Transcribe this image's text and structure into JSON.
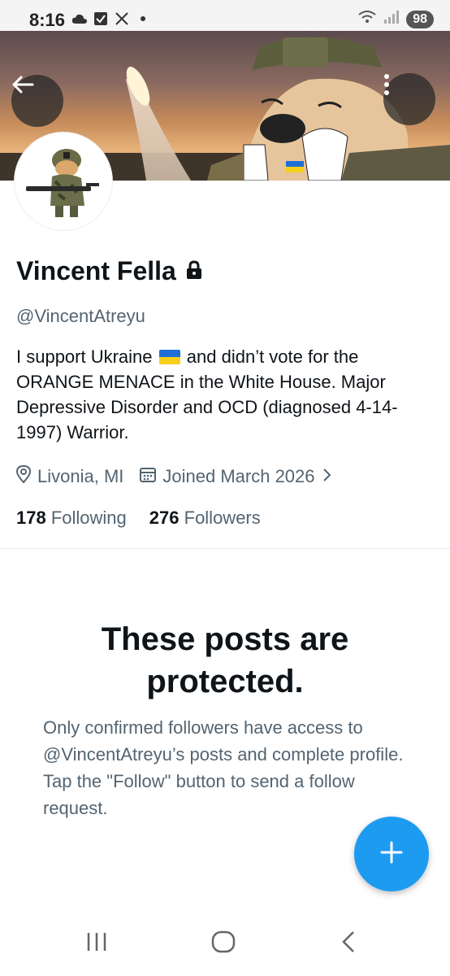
{
  "status_bar": {
    "time": "8:16",
    "battery": "98",
    "icons": [
      "cloud-icon",
      "check-box-icon",
      "x-logo-icon",
      "dot-icon",
      "wifi-icon",
      "signal-icon"
    ]
  },
  "header": {
    "back_icon": "arrow-left-icon",
    "more_icon": "more-vertical-icon"
  },
  "profile": {
    "display_name": "Vincent Fella",
    "protected_icon": "lock-icon",
    "handle": "@VincentAtreyu",
    "bio_part1": "I support Ukraine",
    "bio_part2": "and didn’t vote for the ORANGE MENACE in the White House. Major Depressive Disorder and OCD (diagnosed 4-14-1997) Warrior.",
    "location": "Livonia, MI",
    "joined": "Joined March 2026",
    "following_count": "178",
    "following_label": "Following",
    "followers_count": "276",
    "followers_label": "Followers"
  },
  "protected_notice": {
    "title": "These posts are protected.",
    "body": "Only confirmed followers have access to @VincentAtreyu’s posts and complete profile. Tap the \"Follow\" button to send a follow request."
  },
  "fab": {
    "icon": "plus-icon"
  },
  "colors": {
    "accent": "#1d9bf0",
    "secondary_text": "#536471",
    "primary_text": "#0f1419"
  }
}
